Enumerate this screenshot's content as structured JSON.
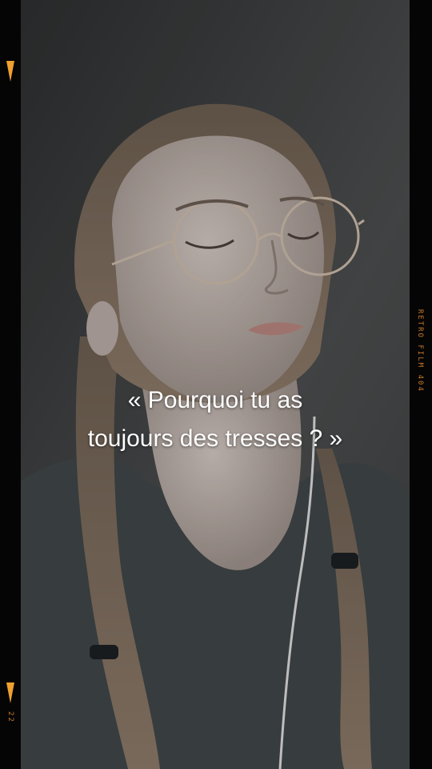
{
  "caption": {
    "line1": "« Pourquoi tu as",
    "line2": "toujours des tresses ? »"
  },
  "film_edge": {
    "right_label": "RETRO   FILM   404",
    "frame_number": "22",
    "marker_color": "#f0a030",
    "label_color": "#c8782a"
  },
  "photo": {
    "icons": [
      "person-portrait"
    ],
    "palette": {
      "background": "#3a3c3d",
      "sweater": "#3f4547",
      "skin": "#b9aea8",
      "hair": "#7a6a5a"
    }
  }
}
